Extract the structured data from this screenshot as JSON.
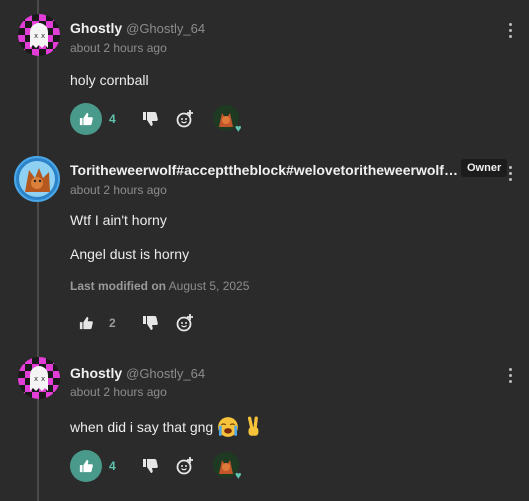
{
  "comments": [
    {
      "author": "Ghostly",
      "handle": "@Ghostly_64",
      "timestamp": "about 2 hours ago",
      "lines": [
        "holy cornball"
      ],
      "like_count": "4",
      "liked": true
    },
    {
      "author": "Toritheweerwolf#accepttheblock#welovetoritheweerwolf…",
      "handle": "",
      "timestamp": "about 2 hours ago",
      "badge": "Owner",
      "lines": [
        "Wtf I ain't horny",
        "Angel dust is horny"
      ],
      "modified_label": "Last modified on",
      "modified_date": "August 5, 2025",
      "like_count": "2",
      "liked": false
    },
    {
      "author": "Ghostly",
      "handle": "@Ghostly_64",
      "timestamp": "about 2 hours ago",
      "lines": [
        "when did i say that gng"
      ],
      "emojis": [
        "loudly-crying-face",
        "victory-hand"
      ],
      "like_count": "4",
      "liked": true
    }
  ],
  "colors": {
    "accent": "#4a9a8c",
    "owner_badge_bg": "#1c1c1c",
    "background": "#2b2b2b"
  }
}
